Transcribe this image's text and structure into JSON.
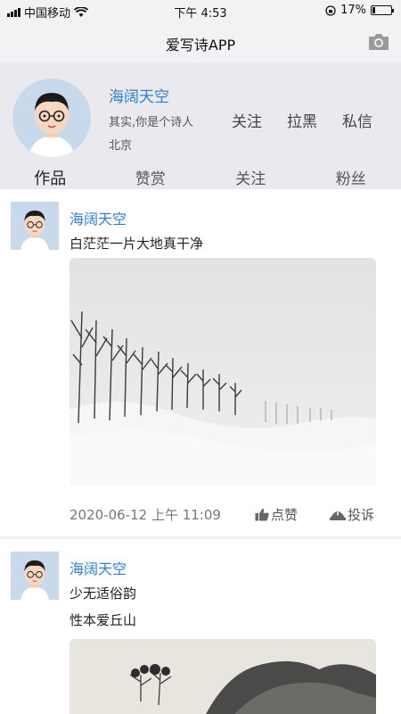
{
  "status_bar": {
    "carrier": "中国移动",
    "time": "下午 4:53",
    "battery": "17%",
    "battery_level": 0.17
  },
  "nav": {
    "title": "爱写诗APP",
    "camera_icon": "camera-icon"
  },
  "profile": {
    "name": "海阔天空",
    "bio": "其实,你是个诗人",
    "location": "北京",
    "actions": [
      "关注",
      "拉黑",
      "私信"
    ]
  },
  "tabs": [
    "作品",
    "赞赏",
    "关注",
    "粉丝"
  ],
  "posts": [
    {
      "author": "海阔天空",
      "lines": [
        "白茫茫一片大地真干净"
      ],
      "date": "2020-06-12 上午 11:09",
      "like_label": "点赞",
      "report_label": "投诉"
    },
    {
      "author": "海阔天空",
      "lines": [
        "少无适俗韵",
        "性本爱丘山"
      ]
    }
  ],
  "colors": {
    "accent": "#2c7fd6",
    "header_bg": "#f2f2f4",
    "profile_bg": "#eaeaee"
  }
}
